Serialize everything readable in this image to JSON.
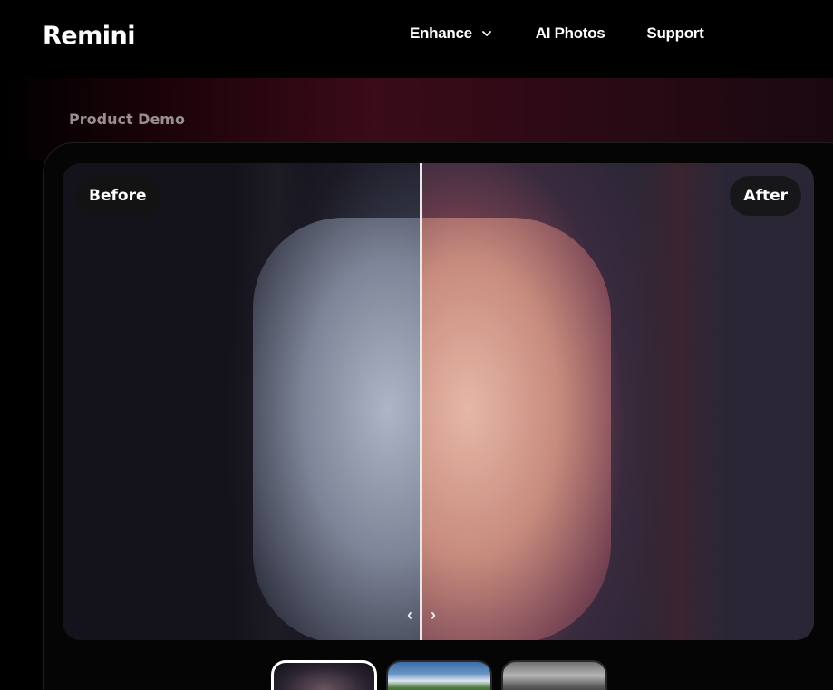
{
  "header": {
    "logo": "Remini",
    "nav": [
      {
        "label": "Enhance",
        "has_dropdown": true
      },
      {
        "label": "AI Photos"
      },
      {
        "label": "Support"
      }
    ]
  },
  "hero": {
    "section_label": "Product Demo"
  },
  "demo": {
    "before_label": "Before",
    "after_label": "After",
    "slider_handle_left": "‹",
    "slider_handle_right": "›",
    "thumbnails": [
      {
        "name": "portrait",
        "active": true
      },
      {
        "name": "mountain-landscape",
        "active": false
      },
      {
        "name": "old-black-white-photo",
        "active": false
      }
    ]
  },
  "colors": {
    "background": "#000000",
    "accent_gradient": "#3a0b18",
    "divider": "#e8e8e8"
  }
}
